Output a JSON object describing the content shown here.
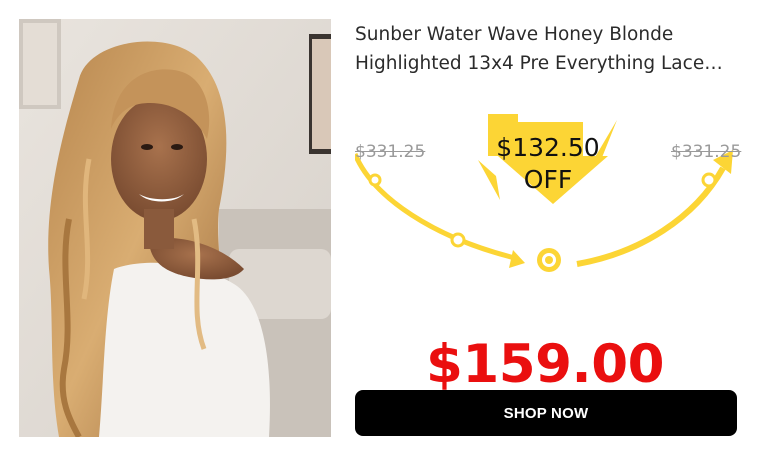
{
  "product": {
    "title_line1": "Sunber Water Wave Honey Blonde",
    "title_line2": "Highlighted 13x4 Pre Everything Lace…",
    "image_icon": "model-portrait-image"
  },
  "pricing": {
    "original_price": "$331.25",
    "discount_line1": "$132.50",
    "discount_line2": "OFF",
    "sale_price": "$159.00"
  },
  "cta": {
    "label": "SHOP NOW"
  },
  "colors": {
    "accent_yellow": "#fcd535",
    "sale_red": "#ea0f0f",
    "button_bg": "#000000",
    "strike_gray": "#9a9a9a"
  }
}
